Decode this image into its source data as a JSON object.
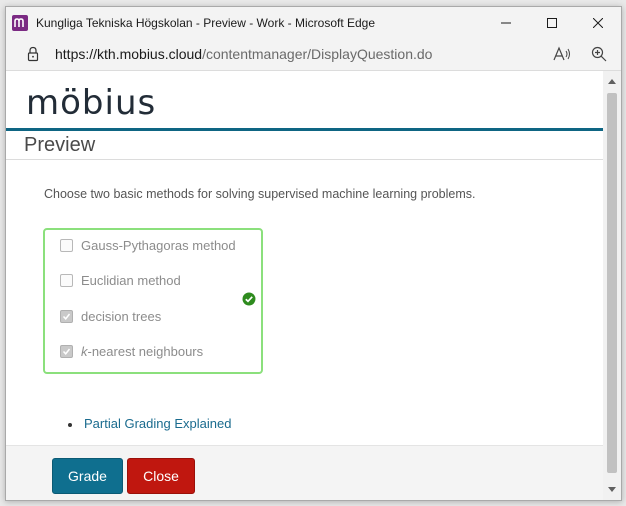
{
  "window": {
    "title": "Kungliga Tekniska Högskolan - Preview - Work - Microsoft Edge",
    "app_icon": "mobius-icon",
    "controls": [
      "minimize-icon",
      "maximize-icon",
      "close-icon"
    ]
  },
  "addressbar": {
    "url_host": "https://kth.mobius.cloud",
    "url_path": "/contentmanager/DisplayQuestion.do",
    "icons": [
      "lock-icon",
      "read-aloud-icon",
      "zoom-icon"
    ]
  },
  "page": {
    "logo": "möbius",
    "heading": "Preview",
    "question": "Choose two basic methods for solving supervised machine learning problems.",
    "choices": [
      {
        "label": "Gauss-Pythagoras method",
        "checked": false
      },
      {
        "label": "Euclidian method",
        "checked": false
      },
      {
        "label": "decision trees",
        "checked": true
      },
      {
        "prefix": "k",
        "label": "-nearest neighbours",
        "checked": true
      }
    ],
    "status": "correct-check-icon",
    "links": [
      "Partial Grading Explained"
    ],
    "buttons": {
      "grade": "Grade",
      "close": "Close"
    }
  },
  "colors": {
    "brand_rule": "#0e6583",
    "answer_border": "#8be07c",
    "grade_button": "#0f6f8f",
    "close_button": "#c0170f",
    "link": "#1a6b8e"
  }
}
